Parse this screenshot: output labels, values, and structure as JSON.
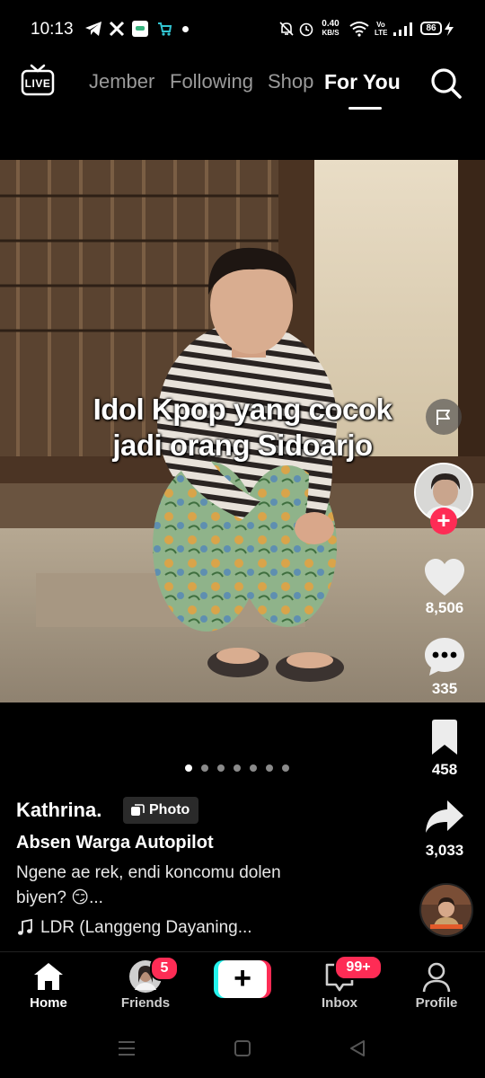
{
  "status_bar": {
    "time": "10:13",
    "speed_value": "0.40",
    "speed_unit": "KB/S",
    "volte_top": "Vo",
    "volte_bottom": "LTE",
    "battery": "86",
    "icons": [
      "telegram-icon",
      "x-icon",
      "app-icon",
      "store-icon",
      "notification-dot",
      "mute-icon",
      "alarm-icon",
      "wifi-icon",
      "signal-icon",
      "battery-icon",
      "charging-icon"
    ]
  },
  "top_nav": {
    "live_label": "LIVE",
    "tabs": [
      {
        "label": "Jember"
      },
      {
        "label": "Following"
      },
      {
        "label": "Shop"
      },
      {
        "label": "For You",
        "active": true
      }
    ]
  },
  "post": {
    "caption_line1": "Idol Kpop yang cocok",
    "caption_line2": "jadi orang Sidoarjo",
    "username": "Kathrina.",
    "badge": "Photo",
    "title": "Absen Warga Autopilot",
    "description_line1": "Ngene ae rek, endi koncomu dolen",
    "description_line2": "biyen? 😏...",
    "music": "LDR (Langgeng Dayaning...",
    "carousel_total": 7,
    "carousel_active": 1
  },
  "actions": {
    "likes": "8,506",
    "comments": "335",
    "bookmarks": "458",
    "shares": "3,033"
  },
  "bottom_nav": {
    "home": "Home",
    "friends": "Friends",
    "friends_badge": "5",
    "create": "+",
    "inbox": "Inbox",
    "inbox_badge": "99+",
    "profile": "Profile"
  },
  "colors": {
    "accent": "#fe2c55",
    "cyan": "#25f4ee",
    "background": "#000000"
  }
}
